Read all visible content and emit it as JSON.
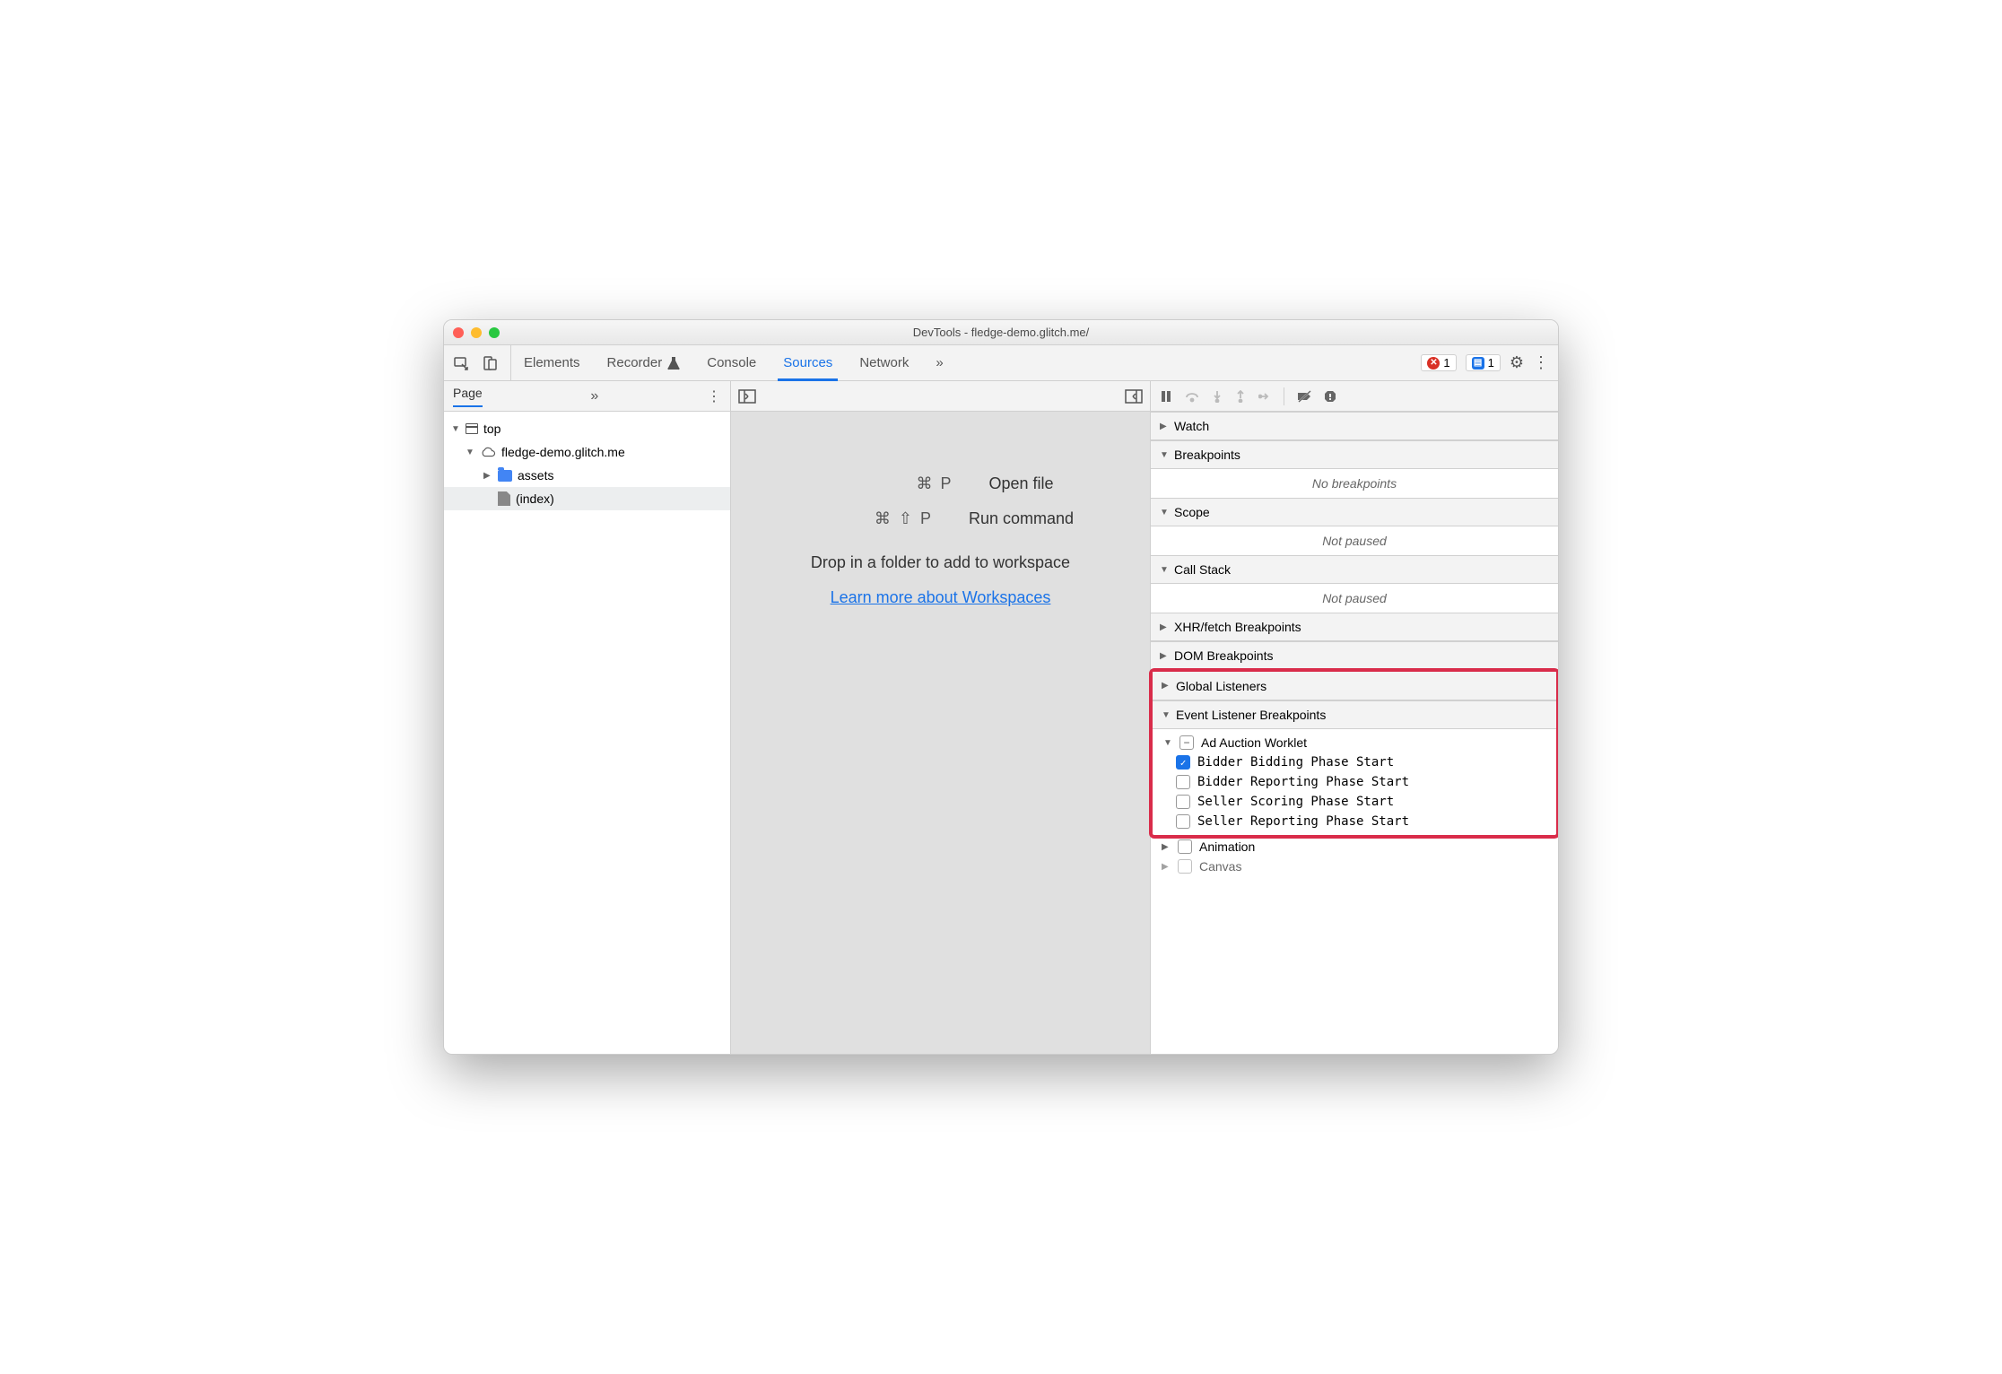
{
  "window": {
    "title": "DevTools - fledge-demo.glitch.me/"
  },
  "toolbar": {
    "tabs": [
      "Elements",
      "Recorder",
      "Console",
      "Sources",
      "Network"
    ],
    "active": "Sources",
    "more_glyph": "»",
    "errors_count": "1",
    "messages_count": "1"
  },
  "left": {
    "tab": "Page",
    "more_glyph": "»",
    "tree": {
      "top": "top",
      "domain": "fledge-demo.glitch.me",
      "folder": "assets",
      "file": "(index)"
    }
  },
  "center": {
    "hints": [
      {
        "keys": "⌘ P",
        "text": "Open file"
      },
      {
        "keys": "⌘ ⇧ P",
        "text": "Run command"
      }
    ],
    "drop_text": "Drop in a folder to add to workspace",
    "link_text": "Learn more about Workspaces"
  },
  "right": {
    "sections": {
      "watch": "Watch",
      "breakpoints": "Breakpoints",
      "breakpoints_empty": "No breakpoints",
      "scope": "Scope",
      "scope_empty": "Not paused",
      "callstack": "Call Stack",
      "callstack_empty": "Not paused",
      "xhr": "XHR/fetch Breakpoints",
      "dom": "DOM Breakpoints",
      "global": "Global Listeners",
      "event_listener": "Event Listener Breakpoints",
      "ad_auction": "Ad Auction Worklet",
      "events": [
        {
          "label": "Bidder Bidding Phase Start",
          "checked": true
        },
        {
          "label": "Bidder Reporting Phase Start",
          "checked": false
        },
        {
          "label": "Seller Scoring Phase Start",
          "checked": false
        },
        {
          "label": "Seller Reporting Phase Start",
          "checked": false
        }
      ],
      "animation": "Animation",
      "canvas": "Canvas"
    }
  }
}
